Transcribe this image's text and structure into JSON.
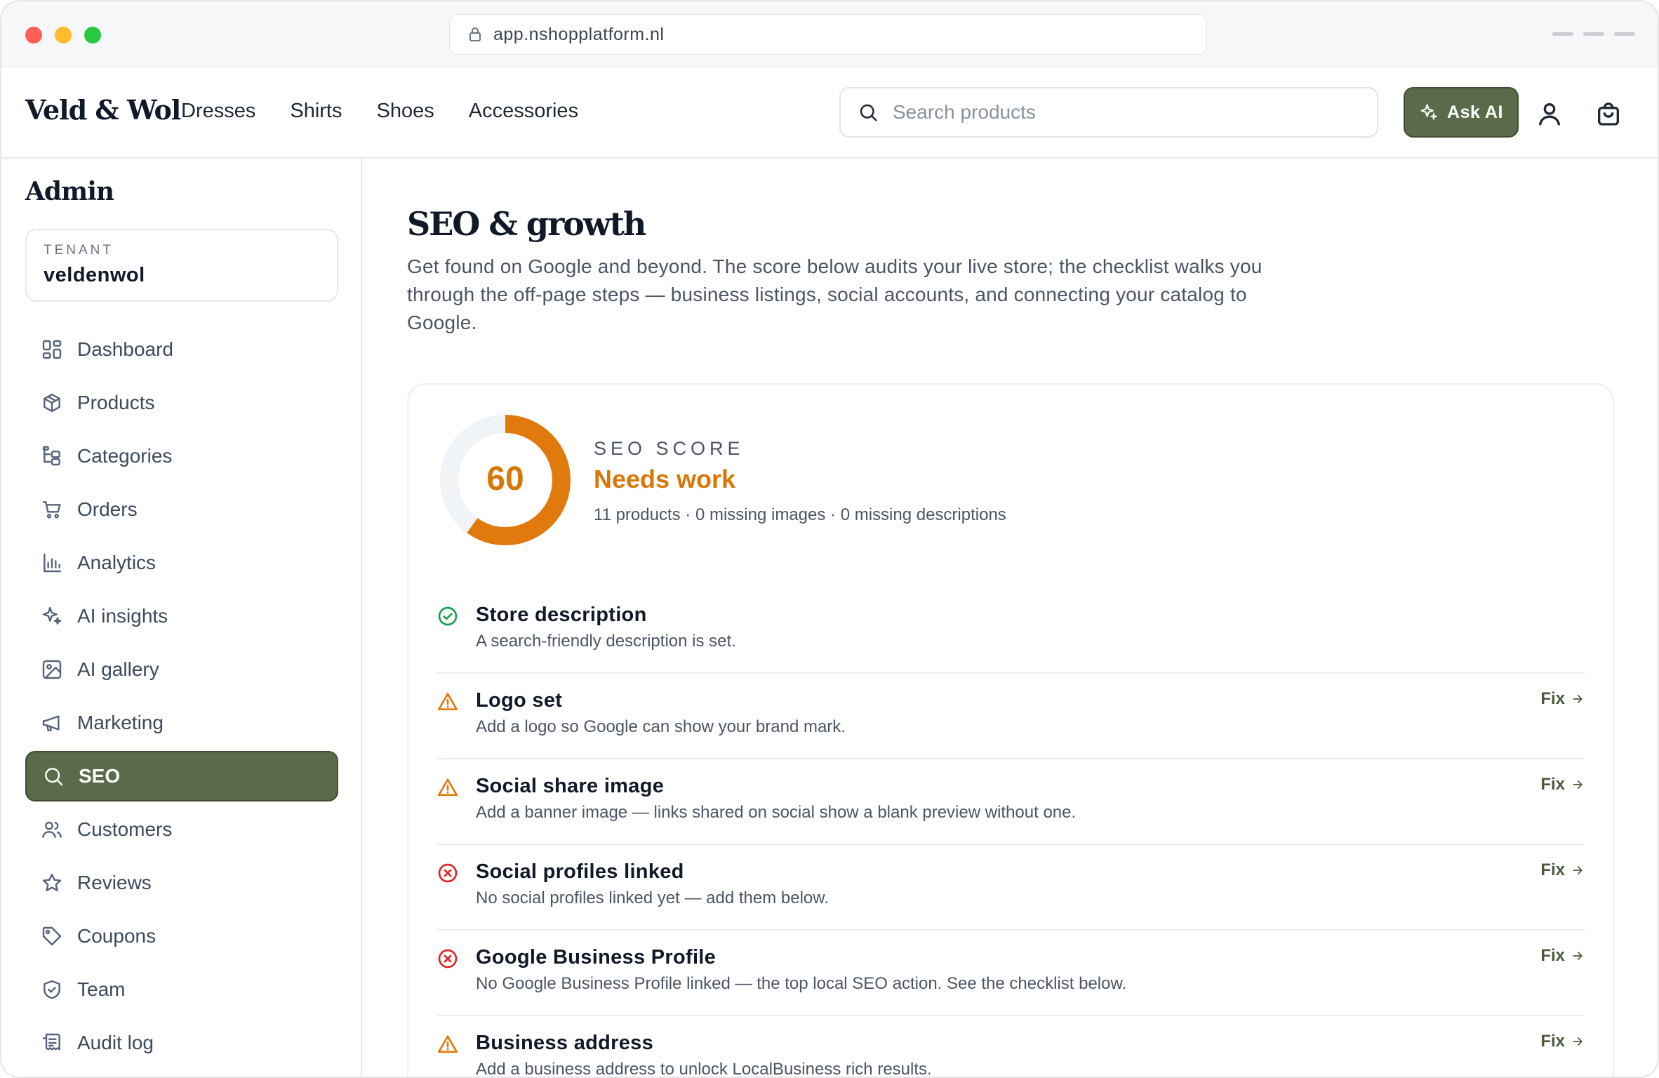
{
  "browser": {
    "url": "app.nshopplatform.nl"
  },
  "header": {
    "brand": "Veld & Wol",
    "nav": [
      "Dresses",
      "Shirts",
      "Shoes",
      "Accessories"
    ],
    "search_placeholder": "Search products",
    "ask_ai_label": "Ask AI"
  },
  "sidebar": {
    "title": "Admin",
    "tenant_label": "TENANT",
    "tenant_value": "veldenwol",
    "items": [
      {
        "label": "Dashboard",
        "icon": "dashboard-icon"
      },
      {
        "label": "Products",
        "icon": "box-icon"
      },
      {
        "label": "Categories",
        "icon": "tree-icon"
      },
      {
        "label": "Orders",
        "icon": "cart-icon"
      },
      {
        "label": "Analytics",
        "icon": "bar-chart-icon"
      },
      {
        "label": "AI insights",
        "icon": "sparkles-icon"
      },
      {
        "label": "AI gallery",
        "icon": "image-icon"
      },
      {
        "label": "Marketing",
        "icon": "megaphone-icon"
      },
      {
        "label": "SEO",
        "icon": "search-icon",
        "active": true
      },
      {
        "label": "Customers",
        "icon": "users-icon"
      },
      {
        "label": "Reviews",
        "icon": "star-icon"
      },
      {
        "label": "Coupons",
        "icon": "tag-icon"
      },
      {
        "label": "Team",
        "icon": "shield-icon"
      },
      {
        "label": "Audit log",
        "icon": "log-icon"
      }
    ]
  },
  "main": {
    "title": "SEO & growth",
    "description": "Get found on Google and beyond. The score below audits your live store; the checklist walks you through the off-page steps — business listings, social accounts, and connecting your catalog to Google.",
    "score": {
      "label": "SEO SCORE",
      "value": "60",
      "percent": 60,
      "status": "Needs work",
      "meta": "11 products · 0 missing images · 0 missing descriptions",
      "colors": {
        "ring": "#e07a0c",
        "track": "#f1f4f7",
        "status": "#d97706"
      }
    },
    "checks": [
      {
        "status": "ok",
        "title": "Store description",
        "subtitle": "A search-friendly description is set.",
        "fix": ""
      },
      {
        "status": "warn",
        "title": "Logo set",
        "subtitle": "Add a logo so Google can show your brand mark.",
        "fix": "Fix"
      },
      {
        "status": "warn",
        "title": "Social share image",
        "subtitle": "Add a banner image — links shared on social show a blank preview without one.",
        "fix": "Fix"
      },
      {
        "status": "error",
        "title": "Social profiles linked",
        "subtitle": "No social profiles linked yet — add them below.",
        "fix": "Fix"
      },
      {
        "status": "error",
        "title": "Google Business Profile",
        "subtitle": "No Google Business Profile linked — the top local SEO action. See the checklist below.",
        "fix": "Fix"
      },
      {
        "status": "warn",
        "title": "Business address",
        "subtitle": "Add a business address to unlock LocalBusiness rich results.",
        "fix": "Fix"
      }
    ]
  }
}
